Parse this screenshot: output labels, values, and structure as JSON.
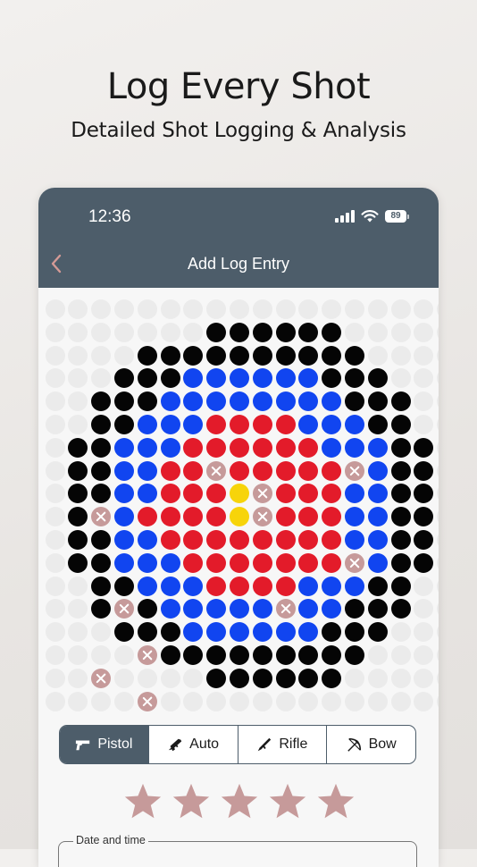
{
  "promo": {
    "headline": "Log Every Shot",
    "subheadline": "Detailed Shot Logging & Analysis"
  },
  "status_bar": {
    "time": "12:36",
    "battery": "89",
    "icons": [
      "cellular-signal-icon",
      "wifi-icon",
      "battery-icon"
    ]
  },
  "nav": {
    "back_icon": "chevron-left-icon",
    "title": "Add Log Entry"
  },
  "target_grid": {
    "legend": {
      "e": "empty",
      "k": "black ring",
      "b": "blue ring",
      "r": "red ring",
      "y": "yellow center",
      "x": "shot marker"
    },
    "rows": [
      "eeeeeeeeeeeeeeeeee",
      "eeeeeeekkkkkkeeeee",
      "eeeekkkkkkkkkkeeee",
      "eeekkkbbbbbbkkkeee",
      "eekkkbbbbbbbbkkkee",
      "eekkbbbrrrrbbbkkee",
      "ekkbbbrrrrrrbbbkke",
      "ekkbbrrxrrrrrxbkke",
      "ekkbbrrryxrrrbbkke",
      "ekxbrrrryxrrrbbkke",
      "ekkbbrrrrrrrrbbkke",
      "ekkbbbrrrrrrrxbkke",
      "eekkbbbrrrrbbbkkee",
      "eekxkbbbbbxbbkkkee",
      "eeekkkbbbbbbkkkeee",
      "eeeexkkkkkkkkkeeee",
      "eexeeeekkkkkkeeeee",
      "eeeexeeeeeeeeeeeee"
    ]
  },
  "weapon_types": {
    "selected": "Pistol",
    "options": [
      {
        "label": "Pistol",
        "icon": "pistol-icon"
      },
      {
        "label": "Auto",
        "icon": "automatic-rifle-icon"
      },
      {
        "label": "Rifle",
        "icon": "rifle-icon"
      },
      {
        "label": "Bow",
        "icon": "bow-icon"
      }
    ]
  },
  "rating": {
    "stars": 5,
    "color": "#c69a9a"
  },
  "form": {
    "date_label": "Date and time"
  },
  "colors": {
    "header": "#4d5d6a",
    "marker": "#c69a9a",
    "black": "#050505",
    "blue": "#1145f0",
    "red": "#e31b2a",
    "yellow": "#f7d40a"
  }
}
